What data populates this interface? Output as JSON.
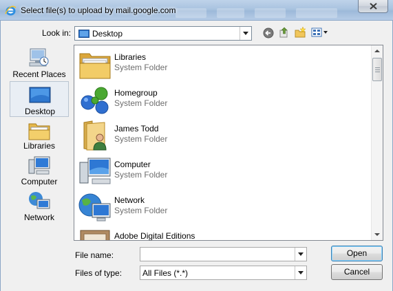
{
  "window": {
    "title": "Select file(s) to upload by mail.google.com"
  },
  "toolbar": {
    "look_in_label": "Look in:",
    "location": "Desktop"
  },
  "places": [
    {
      "label": "Recent Places",
      "icon": "recent-places-icon"
    },
    {
      "label": "Desktop",
      "icon": "desktop-icon",
      "selected": true
    },
    {
      "label": "Libraries",
      "icon": "libraries-icon"
    },
    {
      "label": "Computer",
      "icon": "computer-icon"
    },
    {
      "label": "Network",
      "icon": "network-icon"
    }
  ],
  "files": [
    {
      "name": "Libraries",
      "type": "System Folder",
      "icon": "libraries-folder-icon"
    },
    {
      "name": "Homegroup",
      "type": "System Folder",
      "icon": "homegroup-icon"
    },
    {
      "name": "James Todd",
      "type": "System Folder",
      "icon": "user-folder-icon"
    },
    {
      "name": "Computer",
      "type": "System Folder",
      "icon": "computer-icon"
    },
    {
      "name": "Network",
      "type": "System Folder",
      "icon": "network-icon"
    },
    {
      "name": "Adobe Digital Editions",
      "type": "",
      "icon": "shortcut-folder-icon"
    }
  ],
  "form": {
    "file_name_label": "File name:",
    "file_name_value": "",
    "files_of_type_label": "Files of type:",
    "files_of_type_value": "All Files (*.*)"
  },
  "buttons": {
    "open": "Open",
    "cancel": "Cancel"
  },
  "colors": {
    "selection": "#e9eef4",
    "secondary_text": "#6d6d6d",
    "title_glass": "#a9c3e0"
  }
}
